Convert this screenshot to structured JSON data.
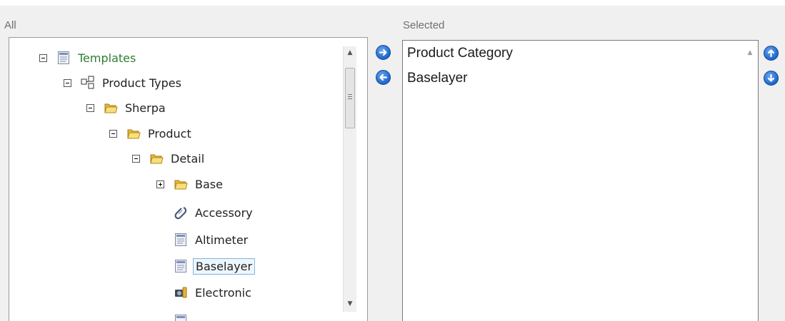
{
  "labels": {
    "all": "All",
    "selected": "Selected"
  },
  "tree": {
    "nodes": [
      {
        "label": "Templates",
        "icon": "template-doc-icon",
        "expander": "minus",
        "color": "#2e7d32"
      },
      {
        "label": "Product Types",
        "icon": "hierarchy-icon",
        "expander": "minus"
      },
      {
        "label": "Sherpa",
        "icon": "folder-icon",
        "expander": "minus"
      },
      {
        "label": "Product",
        "icon": "folder-icon",
        "expander": "minus"
      },
      {
        "label": "Detail",
        "icon": "folder-icon",
        "expander": "minus"
      },
      {
        "label": "Base",
        "icon": "folder-icon",
        "expander": "plus"
      },
      {
        "label": "Accessory",
        "icon": "paperclip-icon"
      },
      {
        "label": "Altimeter",
        "icon": "template-doc-icon"
      },
      {
        "label": "Baselayer",
        "icon": "template-doc-icon",
        "selected": true
      },
      {
        "label": "Electronic",
        "icon": "electronic-device-icon"
      }
    ]
  },
  "selected_list": {
    "items": [
      "Product Category",
      "Baselayer"
    ]
  },
  "buttons": {
    "add": "arrow-right-icon",
    "remove": "arrow-left-icon",
    "move_up": "arrow-up-icon",
    "move_down": "arrow-down-icon"
  },
  "colors": {
    "accent": "#1c66c9",
    "tree_text_highlight": "#2e7d32",
    "selection_border": "#7fb4e4"
  }
}
